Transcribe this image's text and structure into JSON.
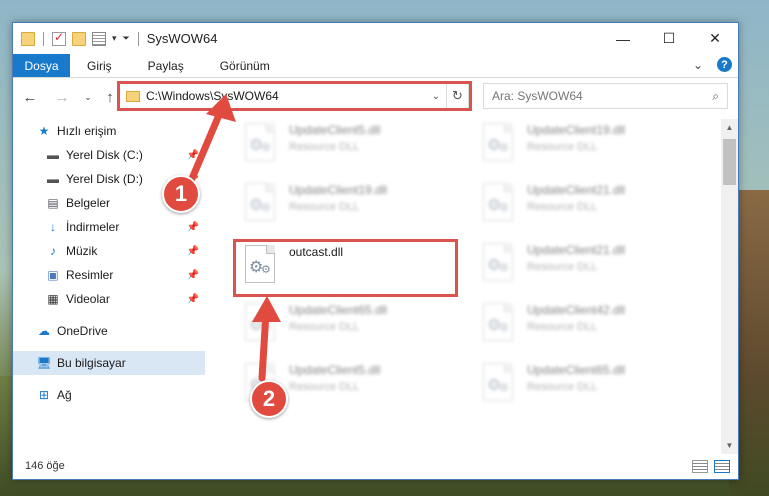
{
  "window": {
    "title": "SysWOW64",
    "controls": [
      "minimize-icon",
      "maximize-icon",
      "close-icon"
    ]
  },
  "ribbon": {
    "file_tab": "Dosya",
    "tabs": [
      "Giriş",
      "Paylaş",
      "Görünüm"
    ]
  },
  "address": {
    "path": "C:\\Windows\\SysWOW64"
  },
  "search": {
    "placeholder": "Ara: SysWOW64"
  },
  "sidebar": {
    "items": [
      {
        "label": "Hızlı erişim",
        "icon": "star-icon"
      },
      {
        "label": "Yerel Disk (C:)",
        "icon": "drive-icon"
      },
      {
        "label": "Yerel Disk (D:)",
        "icon": "drive-icon"
      },
      {
        "label": "Belgeler",
        "icon": "document-icon"
      },
      {
        "label": "İndirmeler",
        "icon": "download-icon"
      },
      {
        "label": "Müzik",
        "icon": "music-icon"
      },
      {
        "label": "Resimler",
        "icon": "pictures-icon"
      },
      {
        "label": "Videolar",
        "icon": "video-icon"
      },
      {
        "label": "OneDrive",
        "icon": "cloud-icon"
      },
      {
        "label": "Bu bilgisayar",
        "icon": "computer-icon"
      },
      {
        "label": "Ağ",
        "icon": "network-icon"
      }
    ]
  },
  "files": {
    "highlighted": {
      "name": "outcast.dll",
      "type": ""
    },
    "blurred": [
      {
        "name": "UpdateClient5.dll",
        "type": "Resource DLL"
      },
      {
        "name": "UpdateClient19.dll",
        "type": "Resource DLL"
      },
      {
        "name": "UpdateClient19.dll",
        "type": "Resource DLL"
      },
      {
        "name": "UpdateClient21.dll",
        "type": "Resource DLL"
      },
      {
        "name": "UpdateClient21.dll",
        "type": "Resource DLL"
      },
      {
        "name": "UpdateClient65.dll",
        "type": "Resource DLL"
      },
      {
        "name": "UpdateClient42.dll",
        "type": "Resource DLL"
      },
      {
        "name": "UpdateClient5.dll",
        "type": "Resource DLL"
      },
      {
        "name": "UpdateClient65.dll",
        "type": "Resource DLL"
      }
    ]
  },
  "status": {
    "count": "146 öğe"
  },
  "annotations": {
    "step1": "1",
    "step2": "2",
    "color": "#e04a3f"
  }
}
